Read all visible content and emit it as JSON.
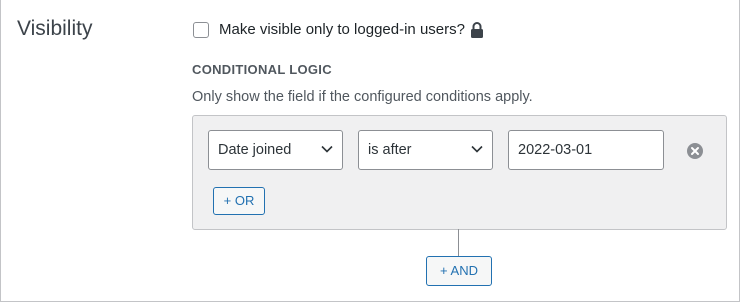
{
  "visibility": {
    "section_label": "Visibility",
    "logged_in_only": {
      "label": "Make visible only to logged-in users?",
      "checked": false,
      "icon": "lock-icon"
    }
  },
  "conditional_logic": {
    "heading": "CONDITIONAL LOGIC",
    "description": "Only show the field if the configured conditions apply.",
    "conditions": [
      {
        "field": "Date joined",
        "operator": "is after",
        "value": "2022-03-01",
        "remove_icon": "close-circle-icon"
      }
    ],
    "or_button_label": "+ OR",
    "and_button_label": "+ AND"
  },
  "colors": {
    "accent": "#2271b1",
    "box_background": "#f0f0f1",
    "border": "#c3c4c7",
    "text": "#1d2327",
    "muted_text": "#50575e"
  }
}
